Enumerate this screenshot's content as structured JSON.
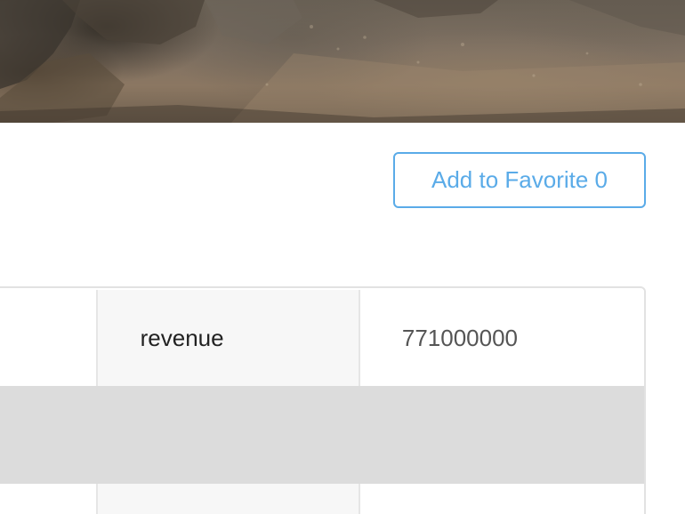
{
  "hero": {
    "image": "dusty-rocky-landscape-photo"
  },
  "favorite": {
    "label": "Add to Favorite 0",
    "accent_color": "#5aabe8"
  },
  "table": {
    "rows": [
      {
        "key": "revenue",
        "value": "771000000"
      },
      {
        "key": "",
        "value": ""
      },
      {
        "key": "",
        "value": ""
      }
    ]
  }
}
